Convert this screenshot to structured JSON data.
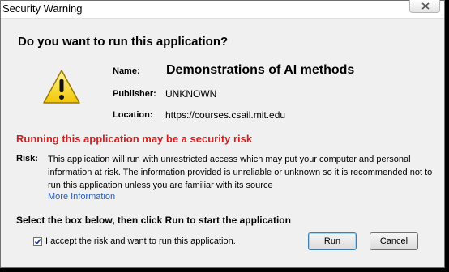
{
  "window": {
    "title": "Security Warning",
    "close_icon": "close-icon"
  },
  "dialog": {
    "heading": "Do you want to run this application?",
    "icon": "warning-triangle-icon",
    "fields": {
      "name_label": "Name:",
      "name_value": "Demonstrations of AI methods",
      "publisher_label": "Publisher:",
      "publisher_value": "UNKNOWN",
      "location_label": "Location:",
      "location_value": "https://courses.csail.mit.edu"
    },
    "risk_warning": "Running this application may be a security risk",
    "risk_label": "Risk:",
    "risk_text": "This application will run with unrestricted access which may put your computer and personal information at risk. The information provided is unreliable or unknown so it is recommended not to run this application unless you are familiar with its source",
    "more_info_link": "More Information",
    "instruction": "Select the box below, then click Run to start the application",
    "accept_checkbox_label": "I accept the risk and want to run this application.",
    "accept_checked": true,
    "run_button": "Run",
    "cancel_button": "Cancel"
  },
  "colors": {
    "warning_text": "#d22020",
    "link": "#2a5db0",
    "window_bg": "#f0f0f0"
  }
}
